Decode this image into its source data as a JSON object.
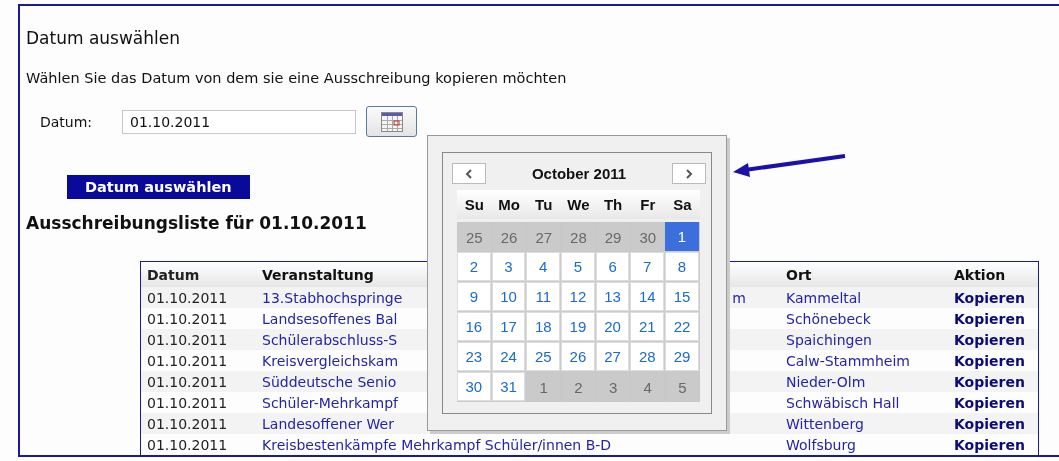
{
  "title": "Datum auswählen",
  "instruction": "Wählen Sie das Datum von dem sie eine Ausschreibung kopieren möchten",
  "date_field": {
    "label": "Datum:",
    "value": "01.10.2011"
  },
  "submit_button": "Datum auswählen",
  "list_heading": "Ausschreibungsliste für 01.10.2011",
  "table": {
    "columns": [
      "Datum",
      "Veranstaltung",
      "Ort",
      "Aktion"
    ],
    "rows": [
      {
        "datum": "01.10.2011",
        "veranstaltung": "13.Stabhochspringe",
        "veranstaltung_tail": "m",
        "ort": "Kammeltal",
        "aktion": "Kopieren"
      },
      {
        "datum": "01.10.2011",
        "veranstaltung": "Landsesoffenes Bal",
        "ort": "Schönebeck",
        "aktion": "Kopieren"
      },
      {
        "datum": "01.10.2011",
        "veranstaltung": "Schülerabschluss-S",
        "ort": "Spaichingen",
        "aktion": "Kopieren"
      },
      {
        "datum": "01.10.2011",
        "veranstaltung": "Kreisvergleichskam",
        "ort": "Calw-Stammheim",
        "aktion": "Kopieren"
      },
      {
        "datum": "01.10.2011",
        "veranstaltung": "Süddeutsche Senio",
        "ort": "Nieder-Olm",
        "aktion": "Kopieren"
      },
      {
        "datum": "01.10.2011",
        "veranstaltung": "Schüler-Mehrkampf",
        "ort": "Schwäbisch Hall",
        "aktion": "Kopieren"
      },
      {
        "datum": "01.10.2011",
        "veranstaltung": "Landesoffener Wer",
        "ort": "Wittenberg",
        "aktion": "Kopieren"
      },
      {
        "datum": "01.10.2011",
        "veranstaltung": "Kreisbestenkämpfe Mehrkampf Schüler/innen B-D",
        "ort": "Wolfsburg",
        "aktion": "Kopieren"
      }
    ]
  },
  "calendar": {
    "month": "October 2011",
    "weekdays": [
      "Su",
      "Mo",
      "Tu",
      "We",
      "Th",
      "Fr",
      "Sa"
    ],
    "days": [
      {
        "label": "25",
        "outside": true,
        "selected": false
      },
      {
        "label": "26",
        "outside": true,
        "selected": false
      },
      {
        "label": "27",
        "outside": true,
        "selected": false
      },
      {
        "label": "28",
        "outside": true,
        "selected": false
      },
      {
        "label": "29",
        "outside": true,
        "selected": false
      },
      {
        "label": "30",
        "outside": true,
        "selected": false
      },
      {
        "label": "1",
        "outside": false,
        "selected": true
      },
      {
        "label": "2",
        "outside": false,
        "selected": false
      },
      {
        "label": "3",
        "outside": false,
        "selected": false
      },
      {
        "label": "4",
        "outside": false,
        "selected": false
      },
      {
        "label": "5",
        "outside": false,
        "selected": false
      },
      {
        "label": "6",
        "outside": false,
        "selected": false
      },
      {
        "label": "7",
        "outside": false,
        "selected": false
      },
      {
        "label": "8",
        "outside": false,
        "selected": false
      },
      {
        "label": "9",
        "outside": false,
        "selected": false
      },
      {
        "label": "10",
        "outside": false,
        "selected": false
      },
      {
        "label": "11",
        "outside": false,
        "selected": false
      },
      {
        "label": "12",
        "outside": false,
        "selected": false
      },
      {
        "label": "13",
        "outside": false,
        "selected": false
      },
      {
        "label": "14",
        "outside": false,
        "selected": false
      },
      {
        "label": "15",
        "outside": false,
        "selected": false
      },
      {
        "label": "16",
        "outside": false,
        "selected": false
      },
      {
        "label": "17",
        "outside": false,
        "selected": false
      },
      {
        "label": "18",
        "outside": false,
        "selected": false
      },
      {
        "label": "19",
        "outside": false,
        "selected": false
      },
      {
        "label": "20",
        "outside": false,
        "selected": false
      },
      {
        "label": "21",
        "outside": false,
        "selected": false
      },
      {
        "label": "22",
        "outside": false,
        "selected": false
      },
      {
        "label": "23",
        "outside": false,
        "selected": false
      },
      {
        "label": "24",
        "outside": false,
        "selected": false
      },
      {
        "label": "25",
        "outside": false,
        "selected": false
      },
      {
        "label": "26",
        "outside": false,
        "selected": false
      },
      {
        "label": "27",
        "outside": false,
        "selected": false
      },
      {
        "label": "28",
        "outside": false,
        "selected": false
      },
      {
        "label": "29",
        "outside": false,
        "selected": false
      },
      {
        "label": "30",
        "outside": false,
        "selected": false
      },
      {
        "label": "31",
        "outside": false,
        "selected": false
      },
      {
        "label": "1",
        "outside": true,
        "selected": false
      },
      {
        "label": "2",
        "outside": true,
        "selected": false
      },
      {
        "label": "3",
        "outside": true,
        "selected": false
      },
      {
        "label": "4",
        "outside": true,
        "selected": false
      },
      {
        "label": "5",
        "outside": true,
        "selected": false
      }
    ]
  }
}
